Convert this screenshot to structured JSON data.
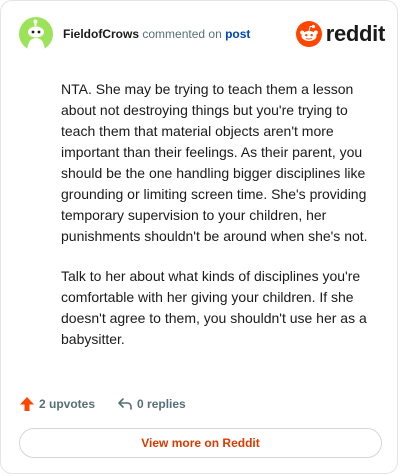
{
  "header": {
    "username": "FieldofCrows",
    "action_text": "commented on",
    "post_link": "post",
    "brand": "reddit"
  },
  "comment": {
    "paragraphs": [
      "NTA. She may be trying to teach them a lesson about not destroying things but you're trying to teach them that material objects aren't more important than their feelings. As their parent, you should be the one handling bigger disciplines like grounding or limiting screen time. She's providing temporary supervision to your children, her punishments shouldn't be around when she's not.",
      "Talk to her about what kinds of disciplines you're comfortable with her giving your children. If she doesn't agree to them, you shouldn't use her as a babysitter."
    ]
  },
  "actions": {
    "upvotes": "2 upvotes",
    "replies": "0 replies"
  },
  "footer": {
    "view_more": "View more on Reddit"
  },
  "colors": {
    "brand": "#ff4500",
    "avatar_bg": "#9de35a",
    "link": "#0045ac",
    "view_more": "#d93a00"
  }
}
